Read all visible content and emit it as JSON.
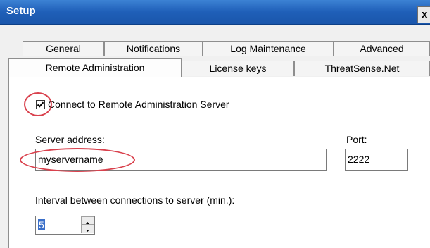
{
  "window": {
    "title": "Setup",
    "close_label": "x"
  },
  "tabs_back": [
    {
      "label": "General"
    },
    {
      "label": "Notifications"
    },
    {
      "label": "Log Maintenance"
    },
    {
      "label": "Advanced"
    }
  ],
  "tabs_front": [
    {
      "label": "Remote Administration",
      "active": true
    },
    {
      "label": "License keys"
    },
    {
      "label": "ThreatSense.Net"
    }
  ],
  "remote": {
    "connect_label": "Connect to Remote Administration Server",
    "connect_checked": true,
    "server_address_label": "Server address:",
    "server_address_value": "myservername",
    "port_label": "Port:",
    "port_value": "2222",
    "interval_label": "Interval between connections to server (min.):",
    "interval_value": "5"
  },
  "colors": {
    "annotation": "#d9414d",
    "titlebar": "#1f5fb8"
  }
}
